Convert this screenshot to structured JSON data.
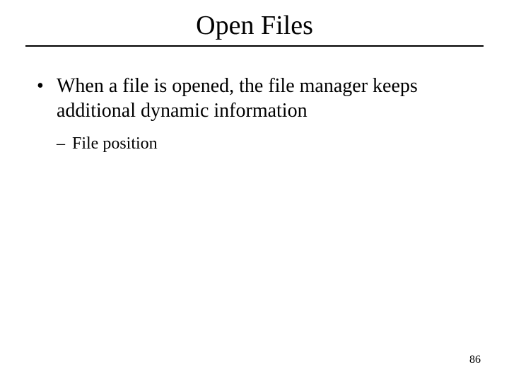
{
  "slide": {
    "title": "Open Files",
    "bullets": [
      {
        "marker": "•",
        "text": "When a file is opened, the file manager keeps additional dynamic information",
        "sub": [
          {
            "marker": "–",
            "text": "File position"
          }
        ]
      }
    ],
    "page_number": "86"
  }
}
